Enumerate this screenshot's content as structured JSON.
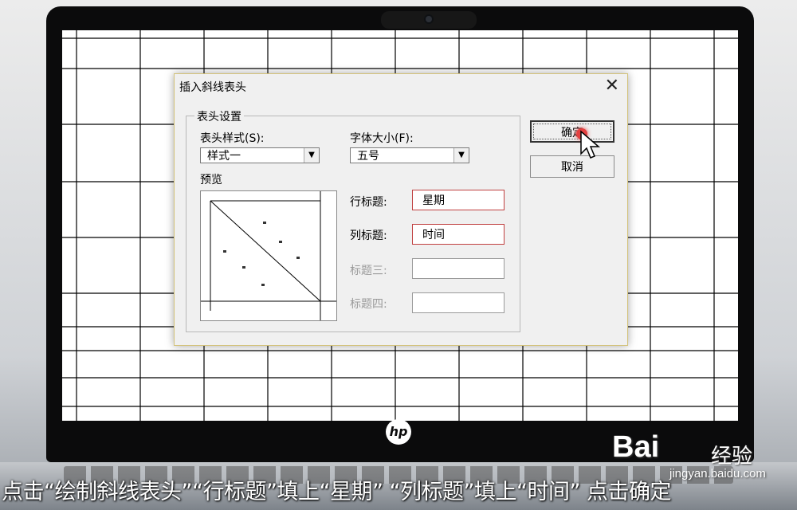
{
  "dialog": {
    "title": "插入斜线表头",
    "close_icon": "close-icon",
    "group_label": "表头设置",
    "header_style_label": "表头样式(S):",
    "header_style_value": "样式一",
    "font_size_label": "字体大小(F):",
    "font_size_value": "五号",
    "preview_label": "预览",
    "row_title_label": "行标题:",
    "row_title_value": "星期",
    "col_title_label": "列标题:",
    "col_title_value": "时间",
    "title3_label": "标题三:",
    "title3_value": "",
    "title4_label": "标题四:",
    "title4_value": "",
    "ok_label": "确定",
    "cancel_label": "取消"
  },
  "device": {
    "logo_text": "hp"
  },
  "watermark": {
    "brand": "Bai",
    "brand_cn": "经验",
    "url": "jingyan.baidu.com"
  },
  "caption": "点击“绘制斜线表头”“行标题”填上“星期” “列标题”填上“时间” 点击确定",
  "colors": {
    "dialog_border": "#d3c27a",
    "active_input_border": "#c04040",
    "click_marker": "#e54040"
  }
}
